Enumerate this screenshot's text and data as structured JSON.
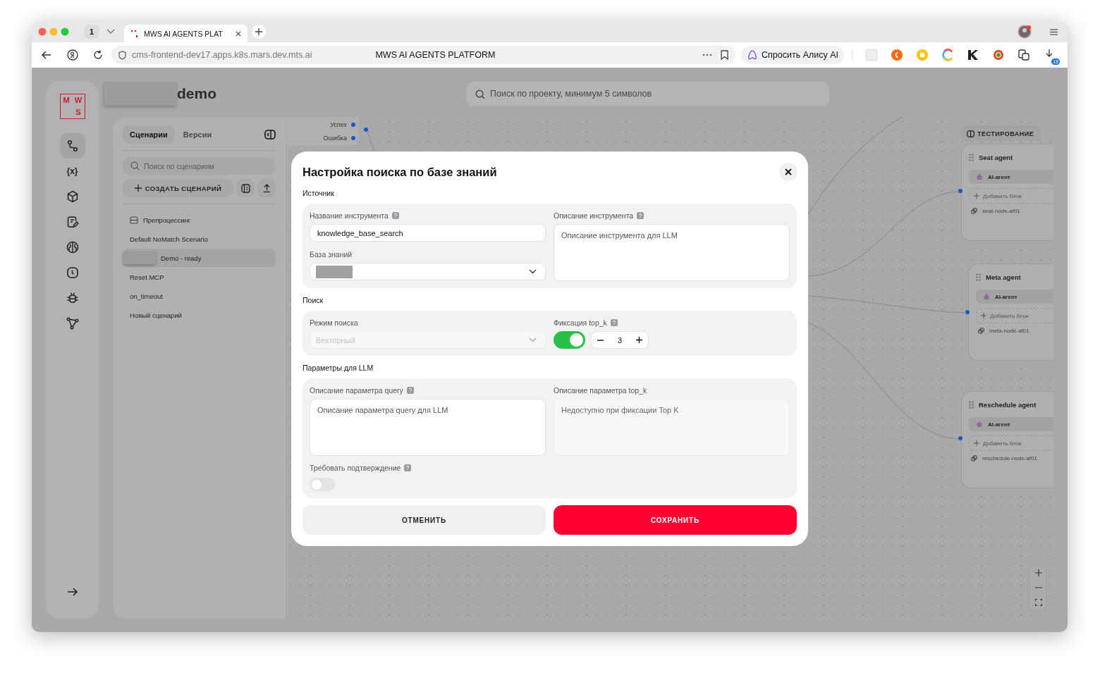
{
  "browser": {
    "tab_count": "1",
    "tab_title": "MWS AI AGENTS PLAT",
    "url": "cms-frontend-dev17.apps.k8s.mars.dev.mts.ai",
    "page_title": "MWS AI AGENTS PLATFORM",
    "alice_button": "Спросить Алису AI",
    "extension_badge": "18"
  },
  "logo": [
    "M",
    "W",
    "S"
  ],
  "sidebar": {
    "items": [
      {
        "selected": true
      },
      {
        "glyph": "{x}",
        "selected": false
      },
      {
        "selected": false
      },
      {
        "selected": false
      },
      {
        "selected": false
      },
      {
        "selected": false
      },
      {
        "selected": false
      },
      {
        "selected": false
      }
    ]
  },
  "project": {
    "title": "demo"
  },
  "search": {
    "placeholder": "Поиск по проекту, минимум 5 символов"
  },
  "scenarios_panel": {
    "tabs": [
      {
        "label": "Сценарии",
        "selected": true
      },
      {
        "label": "Версии",
        "selected": false
      }
    ],
    "search_placeholder": "Поиск по сценариям",
    "create_button": "СОЗДАТЬ СЦЕНАРИЙ",
    "items": [
      {
        "label": "Препроцессинг",
        "kind": "folder",
        "selected": false
      },
      {
        "label": "Default NoMatch Scenario",
        "kind": "plain",
        "selected": false
      },
      {
        "label": "Demo - ready",
        "kind": "plain",
        "selected": true
      },
      {
        "label": "Reset MCP",
        "kind": "plain",
        "selected": false
      },
      {
        "label": "on_timeout",
        "kind": "plain",
        "selected": false
      },
      {
        "label": "Новый сценарий",
        "kind": "plain",
        "selected": false
      }
    ]
  },
  "canvas": {
    "outputs": [
      "Успех",
      "Ошибка"
    ],
    "testing_button": "ТЕСТИРОВАНИЕ",
    "nodes": [
      {
        "title": "Seat agent",
        "block": "AI-агент",
        "add_block": "Добавить блок",
        "node_id": "seat-node-af01"
      },
      {
        "title": "Meta agent",
        "block": "AI-агент",
        "add_block": "Добавить блок",
        "node_id": "meta-node-af01"
      },
      {
        "title": "Reschedule agent",
        "block": "AI-агент",
        "add_block": "Добавить блок",
        "node_id": "reschedule-node-af01"
      }
    ]
  },
  "modal": {
    "title": "Настройка поиска по базе знаний",
    "source_label": "Источник",
    "tool_name": {
      "label": "Название инструмента",
      "value": "knowledge_base_search"
    },
    "tool_description": {
      "label": "Описание инструмента",
      "placeholder": "Описание инструмента для LLM"
    },
    "knowledge_base": {
      "label": "База знаний"
    },
    "search_label": "Поиск",
    "search_mode": {
      "label": "Режим поиска",
      "placeholder": "Векторный",
      "disabled": true
    },
    "top_k": {
      "label": "Фиксация top_k",
      "on": true,
      "value": "3"
    },
    "llm_label": "Параметры для LLM",
    "query_description": {
      "label": "Описание параметра query",
      "placeholder": "Описание параметра query для LLM",
      "disabled": false
    },
    "top_k_description": {
      "label": "Описание параметра top_k",
      "placeholder": "Недоступно при фиксации Top K",
      "disabled": true
    },
    "confirmation": {
      "label": "Требовать подтверждение",
      "on": false
    },
    "cancel": "ОТМЕНИТЬ",
    "save": "СОХРАНИТЬ"
  }
}
